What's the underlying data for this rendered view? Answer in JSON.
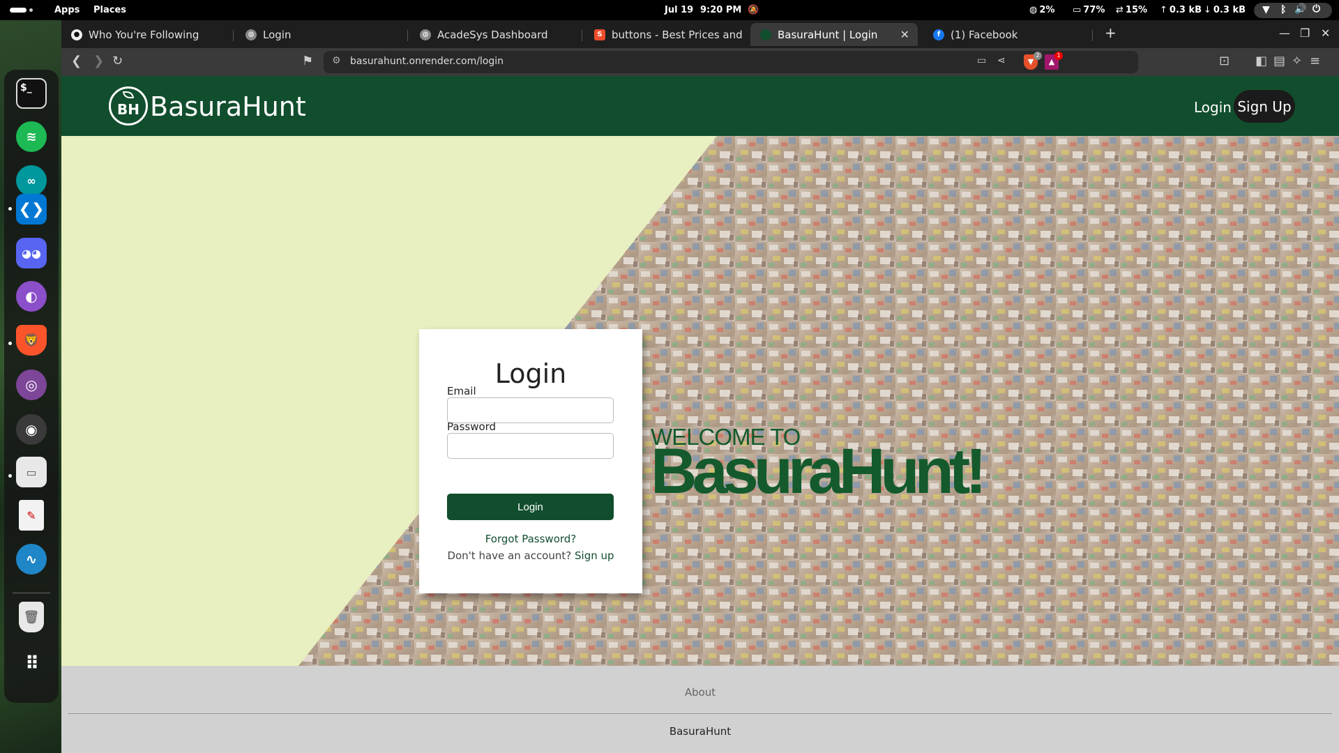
{
  "system": {
    "apps_label": "Apps",
    "places_label": "Places",
    "date": "Jul 19",
    "time": "9:20 PM",
    "cpu": "2%",
    "memory": "77%",
    "swap": "15%",
    "upload": "0.3 kB",
    "download": "0.3 kB"
  },
  "dock": {
    "apps": [
      "terminal-icon",
      "spotify-icon",
      "arduino-icon",
      "vscode-icon",
      "discord-icon",
      "github-desktop-icon",
      "brave-icon",
      "tor-browser-icon",
      "inkscape-icon",
      "files-icon",
      "text-editor-icon",
      "wireshark-icon",
      "trash-icon",
      "show-apps-icon"
    ]
  },
  "browser": {
    "tabs": [
      {
        "title": "Who You're Following",
        "favicon": "github-icon"
      },
      {
        "title": "Login",
        "favicon": "globe-icon"
      },
      {
        "title": "AcadeSys Dashboard",
        "favicon": "globe-icon"
      },
      {
        "title": "buttons - Best Prices and Onl",
        "favicon": "shopee-icon"
      },
      {
        "title": "BasuraHunt | Login",
        "favicon": "basurahunt-icon"
      },
      {
        "title": "(1) Facebook",
        "favicon": "facebook-icon"
      }
    ],
    "new_tab": "+",
    "url": "basurahunt.onrender.com/login",
    "shield_count": "2",
    "rewards_count": "1"
  },
  "site": {
    "brand": "BasuraHunt",
    "logo_text": "BH",
    "nav": {
      "login": "Login",
      "signup": "Sign Up"
    },
    "hero": {
      "welcome": "WELCOME TO",
      "title": "BasuraHunt!"
    },
    "login_form": {
      "title": "Login",
      "email_label": "Email",
      "email_value": "",
      "password_label": "Password",
      "password_value": "",
      "submit": "Login",
      "forgot": "Forgot Password?",
      "no_account": "Don't have an account?",
      "signup_link": "Sign up"
    },
    "footer": {
      "about": "About",
      "brand": "BasuraHunt"
    }
  },
  "colors": {
    "brand_green": "#114e2d",
    "hero_bg": "#e8efc0",
    "footer_bg": "#d1d1d1"
  }
}
